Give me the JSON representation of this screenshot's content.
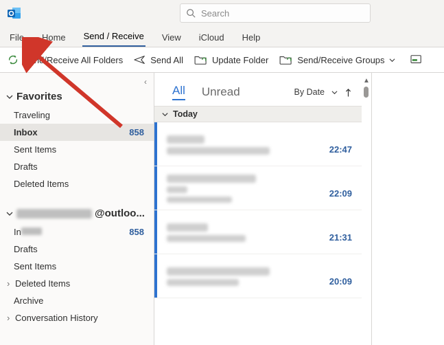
{
  "search": {
    "placeholder": "Search"
  },
  "menu": {
    "items": [
      "File",
      "Home",
      "Send / Receive",
      "View",
      "iCloud",
      "Help"
    ],
    "active_index": 2
  },
  "ribbon": {
    "send_receive_all": "Send/Receive All Folders",
    "send_all": "Send All",
    "update_folder": "Update Folder",
    "groups": "Send/Receive Groups"
  },
  "sidebar": {
    "favorites": {
      "title": "Favorites",
      "items": [
        {
          "label": "Traveling"
        },
        {
          "label": "Inbox",
          "count": "858",
          "selected": true
        },
        {
          "label": "Sent Items"
        },
        {
          "label": "Drafts"
        },
        {
          "label": "Deleted Items"
        }
      ]
    },
    "account": {
      "suffix": "@outloo...",
      "items": [
        {
          "label_prefix": "In",
          "count": "858",
          "has_blur": true
        },
        {
          "label": "Drafts"
        },
        {
          "label": "Sent Items"
        },
        {
          "label": "Deleted Items",
          "expandable": true
        },
        {
          "label": "Archive"
        },
        {
          "label": "Conversation History",
          "expandable": true
        }
      ]
    }
  },
  "msgpane": {
    "tabs": {
      "all": "All",
      "unread": "Unread"
    },
    "sort": {
      "by_date": "By Date"
    },
    "group": "Today",
    "messages": [
      {
        "time": "22:47"
      },
      {
        "time": "22:09"
      },
      {
        "time": "21:31"
      },
      {
        "time": "20:09"
      }
    ]
  }
}
